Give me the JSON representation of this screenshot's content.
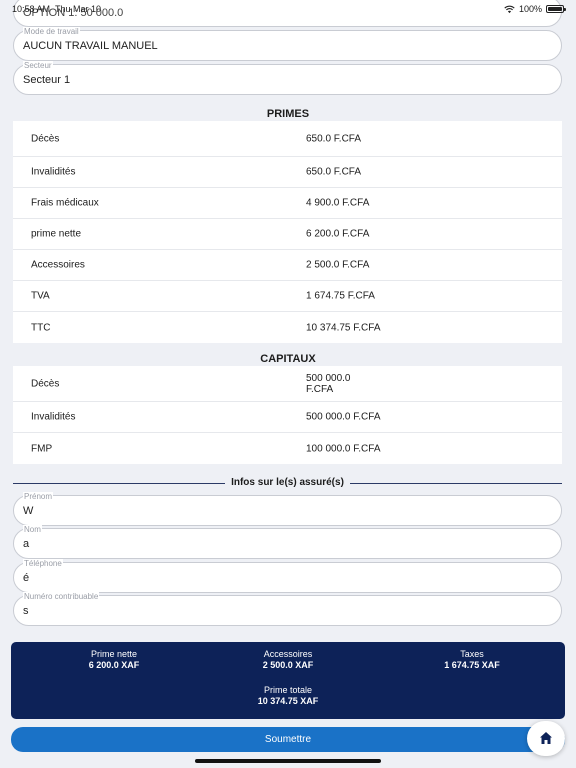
{
  "status": {
    "time": "10:58 AM",
    "date": "Thu Mar 10",
    "battery": "100%"
  },
  "top_field": {
    "value": "OPTION 1: 50 000.0"
  },
  "work_mode": {
    "label": "Mode de travail",
    "value": "AUCUN TRAVAIL MANUEL"
  },
  "sector": {
    "label": "Secteur",
    "value": "Secteur 1"
  },
  "primes": {
    "title": "PRIMES",
    "rows": [
      {
        "label": "Décès",
        "value": "650.0 F.CFA"
      },
      {
        "label": "Invalidités",
        "value": "650.0 F.CFA"
      },
      {
        "label": "Frais médicaux",
        "value": "4 900.0 F.CFA"
      },
      {
        "label": "prime nette",
        "value": "6 200.0 F.CFA"
      },
      {
        "label": "Accessoires",
        "value": "2 500.0 F.CFA"
      },
      {
        "label": "TVA",
        "value": "1 674.75 F.CFA"
      },
      {
        "label": "TTC",
        "value": "10 374.75 F.CFA"
      }
    ]
  },
  "capitaux": {
    "title": "CAPITAUX",
    "rows": [
      {
        "label": "Décès",
        "value": "500 000.0 F.CFA"
      },
      {
        "label": "Invalidités",
        "value": "500 000.0 F.CFA"
      },
      {
        "label": "FMP",
        "value": "100 000.0 F.CFA"
      }
    ]
  },
  "insured": {
    "title": "Infos sur le(s) assuré(s)",
    "fields": [
      {
        "label": "Prénom",
        "value": "W"
      },
      {
        "label": "Nom",
        "value": "a"
      },
      {
        "label": "Téléphone",
        "value": "é"
      },
      {
        "label": "Numéro contribuable",
        "value": "s"
      }
    ]
  },
  "summary": {
    "prime_nette_label": "Prime nette",
    "prime_nette_value": "6 200.0 XAF",
    "accessoires_label": "Accessoires",
    "accessoires_value": "2 500.0 XAF",
    "taxes_label": "Taxes",
    "taxes_value": "1 674.75 XAF",
    "prime_totale_label": "Prime totale",
    "prime_totale_value": "10 374.75 XAF"
  },
  "submit_label": "Soumettre",
  "colors": {
    "navy": "#0d2258",
    "button_blue": "#1a72c7",
    "background": "#eef0f5"
  },
  "icons": [
    "wifi-icon",
    "battery-icon",
    "home-icon"
  ]
}
